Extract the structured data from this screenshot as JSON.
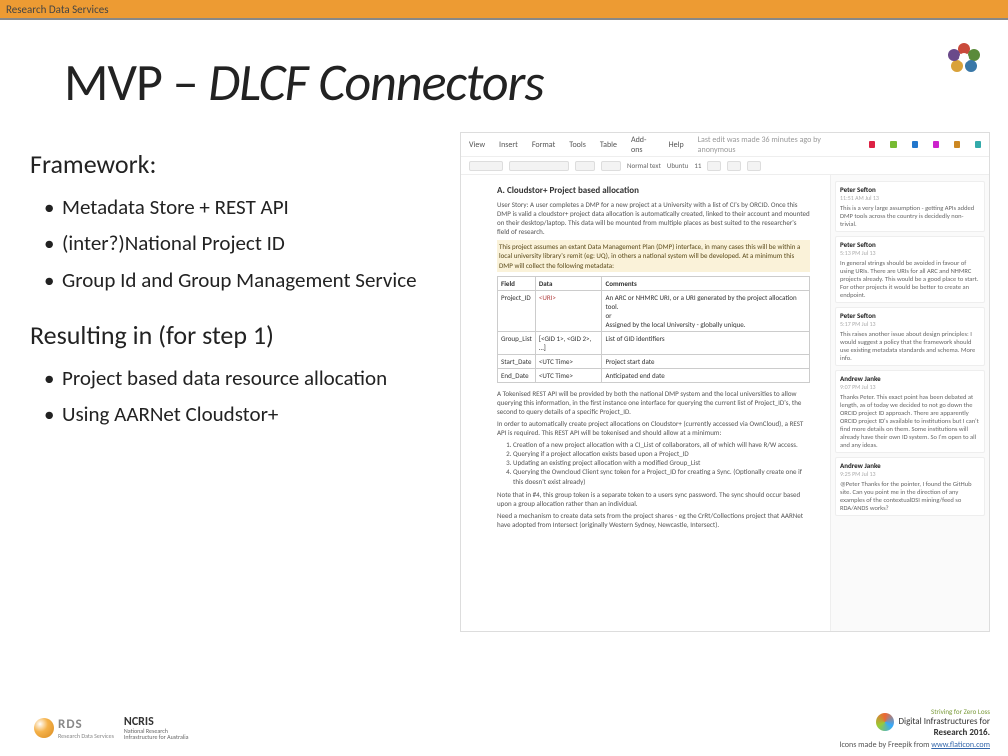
{
  "header": {
    "label": "Research Data Services"
  },
  "title": {
    "part1": "MVP – ",
    "part2": "DLCF Connectors"
  },
  "framework": {
    "heading": "Framework:",
    "items": [
      "Metadata Store + REST API",
      "(inter?)National Project ID",
      "Group Id and Group Management Service"
    ]
  },
  "resulting": {
    "heading": "Resulting in (for step 1)",
    "items": [
      "Project based data resource allocation",
      "Using AARNet Cloudstor+"
    ]
  },
  "doc": {
    "menu": [
      "View",
      "Insert",
      "Format",
      "Tools",
      "Table",
      "Add-ons",
      "Help"
    ],
    "last_edit": "Last edit was made 36 minutes ago by anonymous",
    "avatars": [
      "#d24",
      "#7b3",
      "#27c",
      "#c2c",
      "#c82",
      "#3aa"
    ],
    "heading": "A. Cloudstor+ Project based allocation",
    "story": "User Story: A user completes a DMP for a new project at a University with a list of CI's by ORCID. Once this DMP is valid a cloudstor+ project data allocation is automatically created, linked to their account and mounted on their desktop/laptop. This data will be mounted from multiple places as best suited to the researcher's field of research.",
    "highlight": "This project assumes an extant Data Management Plan (DMP) interface, in many cases this will be within a local university library's remit (eg: UQ), in others a national system will be developed. At a minimum this DMP will collect the following metadata:",
    "table": {
      "header": [
        "Field",
        "Data",
        "Comments"
      ],
      "rows": [
        [
          "Project_ID",
          "<URI>",
          "An ARC or NHMRC URI, or a URI generated by the project allocation tool.\nor\nAssigned by the local University - globally unique."
        ],
        [
          "Group_List",
          "[<GID 1>, <GID 2>, …]",
          "List of GID identifiers"
        ],
        [
          "Start_Date",
          "<UTC Time>",
          "Project start date"
        ],
        [
          "End_Date",
          "<UTC Time>",
          "Anticipated end date"
        ]
      ]
    },
    "para1": "A Tokenised REST API will be provided by both the national DMP system and the local universities to allow querying this information, in the first instance one interface for querying the current list of Project_ID's, the second to query details of a specific Project_ID.",
    "para2": "In order to automatically create project allocations on Cloudstor+ (currently accessed via OwnCloud), a REST API is required. This REST API will be tokenised and should allow at a minimum:",
    "ol": [
      "Creation of a new project allocation with a CI_List of collaborators, all of which will have R/W access.",
      "Querying if a project allocation exists based upon a Project_ID",
      "Updating an existing project allocation with a modified Group_List",
      "Querying the Owncloud Client sync token for a Project_ID for creating a Sync. (Optionally create one if this doesn't exist already)"
    ],
    "note": "Note that in #4, this group token is a separate token to a users sync password. The sync should occur based upon a group allocation rather than an individual.",
    "need": "Need a mechanism to create data sets from the project shares - eg the CrRt/Collections project that AARNet have adopted from Intersect (originally Western Sydney, Newcastle, Intersect).",
    "comments": [
      {
        "name": "Peter Sefton",
        "time": "11:51 AM Jul 13",
        "body": "This is a very large assumption - getting APIs added DMP tools across the country is decidedly non-trivial."
      },
      {
        "name": "Peter Sefton",
        "time": "5:13 PM Jul 13",
        "body": "In general strings should be avoided in favour of using URIs. There are URIs for all ARC and NHMRC projects already. This would be a good place to start. For other projects it would be better to create an endpoint."
      },
      {
        "name": "Peter Sefton",
        "time": "5:17 PM Jul 13",
        "body": "This raises another issue about design principles: I would suggest a policy that the framework should use existing metadata standards and schema. More info."
      },
      {
        "name": "Andrew Janke",
        "time": "9:07 PM Jul 13",
        "body": "Thanks Peter. This exact point has been debated at length, as of today we decided to not go down the ORCID project ID approach. There are apparently ORCID project ID's available to institutions but I can't find more details on them. Some institutions will already have their own ID system. So I'm open to all and any ideas."
      },
      {
        "name": "Andrew Janke",
        "time": "9:25 PM Jul 13",
        "body": "@Peter Thanks for the pointer, I found the GitHub site. Can you point me in the direction of any examples of the contextualDSI mining/feed so RDA/ANDS works?"
      }
    ]
  },
  "footer": {
    "rds": "RDS",
    "rds_sub": "Research Data Services",
    "ncris": "NCRIS",
    "ncris_sub": "National Research\nInfrastructure for Australia",
    "dir_top": "Striving for Zero Loss",
    "dir_brand": "Digital Infrastructures for",
    "dir_brand2": "Research 2016.",
    "credit_pre": "Icons made by Freepik from ",
    "credit_link": "www.flaticon.com"
  }
}
